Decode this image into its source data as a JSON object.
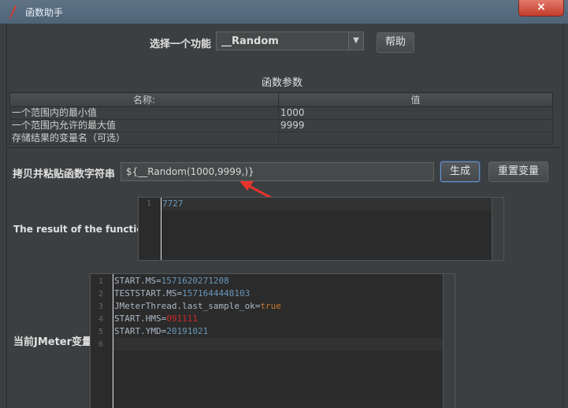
{
  "window": {
    "title": "函数助手",
    "close": "×"
  },
  "function_select": {
    "label": "选择一个功能",
    "value": "__Random",
    "help": "帮助"
  },
  "params": {
    "heading": "函数参数",
    "columns": [
      "名称:",
      "值"
    ],
    "rows": [
      {
        "name": "一个范围内的最小值",
        "value": "1000"
      },
      {
        "name": "一个范围内允许的最大值",
        "value": "9999"
      },
      {
        "name": "存储结果的变量名（可选）",
        "value": ""
      }
    ]
  },
  "function_string": {
    "label": "拷贝并粘贴函数字符串",
    "value": "${__Random(1000,9999,)}",
    "generate": "生成",
    "reset": "重置变量"
  },
  "result": {
    "label": "The result of the function is",
    "line_numbers": [
      "1"
    ],
    "lines": [
      "7727"
    ]
  },
  "variables": {
    "label": "当前JMeter变量",
    "line_numbers": [
      "1",
      "2",
      "3",
      "4",
      "5",
      "6"
    ],
    "lines": [
      {
        "key": "START.MS",
        "value": "1571620271208"
      },
      {
        "key": "TESTSTART.MS",
        "value": "1571644448103"
      },
      {
        "key": "JMeterThread.last_sample_ok",
        "value": "true"
      },
      {
        "key": "START.HMS",
        "value": "091111"
      },
      {
        "key": "START.YMD",
        "value": "20191021"
      }
    ],
    "eq": "="
  },
  "colors": {
    "accent_arrow": "#e8322d",
    "number": "#6897bb",
    "keyword": "#cc7832",
    "highlight": "#cc2a2a"
  }
}
